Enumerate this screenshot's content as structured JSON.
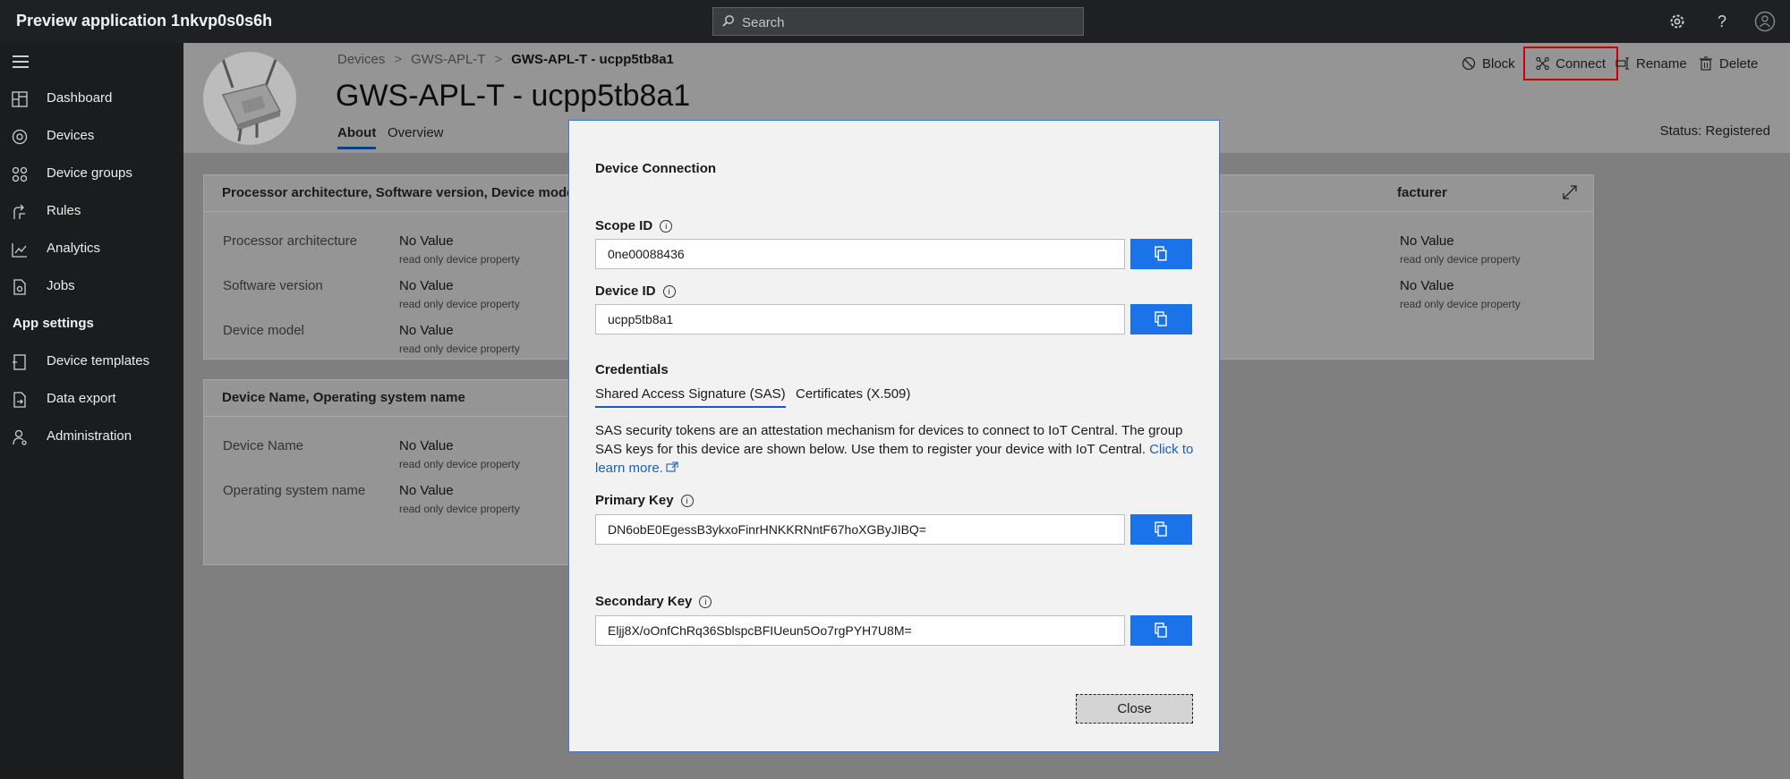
{
  "app": {
    "title": "Preview application 1nkvp0s0s6h"
  },
  "search": {
    "placeholder": "Search"
  },
  "sidebar": {
    "items": [
      {
        "label": "Dashboard"
      },
      {
        "label": "Devices"
      },
      {
        "label": "Device groups"
      },
      {
        "label": "Rules"
      },
      {
        "label": "Analytics"
      },
      {
        "label": "Jobs"
      }
    ],
    "section": "App settings",
    "settings_items": [
      {
        "label": "Device templates"
      },
      {
        "label": "Data export"
      },
      {
        "label": "Administration"
      }
    ]
  },
  "breadcrumb": {
    "root": "Devices",
    "parent": "GWS-APL-T",
    "current": "GWS-APL-T - ucpp5tb8a1"
  },
  "page": {
    "title": "GWS-APL-T - ucpp5tb8a1",
    "tabs": [
      "About",
      "Overview"
    ],
    "status": "Status: Registered"
  },
  "commands": {
    "block": "Block",
    "connect": "Connect",
    "rename": "Rename",
    "delete": "Delete"
  },
  "cards": {
    "card1": {
      "title": "Processor architecture, Software version, Device model",
      "props": [
        {
          "label": "Processor architecture",
          "value": "No Value",
          "sub": "read only device property"
        },
        {
          "label": "Software version",
          "value": "No Value",
          "sub": "read only device property"
        },
        {
          "label": "Device model",
          "value": "No Value",
          "sub": "read only device property"
        }
      ]
    },
    "card2": {
      "title": "Device Name, Operating system name",
      "props": [
        {
          "label": "Device Name",
          "value": "No Value",
          "sub": "read only device property"
        },
        {
          "label": "Operating system name",
          "value": "No Value",
          "sub": "read only device property"
        }
      ]
    },
    "card3": {
      "title": "facturer",
      "props": [
        {
          "value": "No Value",
          "sub": "read only device property"
        },
        {
          "value": "No Value",
          "sub": "read only device property"
        }
      ]
    }
  },
  "modal": {
    "title": "Device Connection",
    "scope_label": "Scope ID",
    "scope_value": "0ne00088436",
    "device_label": "Device ID",
    "device_value": "ucpp5tb8a1",
    "credentials_label": "Credentials",
    "tab_sas": "Shared Access Signature (SAS)",
    "tab_x509": "Certificates (X.509)",
    "description": "SAS security tokens are an attestation mechanism for devices to connect to IoT Central. The group SAS keys for this device are shown below. Use them to register your device with IoT Central. ",
    "learn_more": "Click to learn more.",
    "primary_label": "Primary Key",
    "primary_value": "DN6obE0EgessB3ykxoFinrHNKKRNntF67hoXGByJIBQ=",
    "secondary_label": "Secondary Key",
    "secondary_value": "Eljj8X/oOnfChRq36SblspcBFIUeun5Oo7rgPYH7U8M=",
    "close": "Close"
  }
}
